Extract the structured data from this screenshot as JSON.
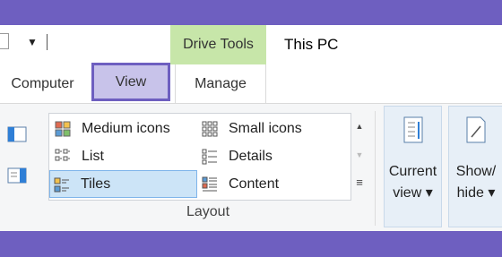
{
  "window": {
    "title": "This PC",
    "context_tab_header": "Drive Tools"
  },
  "tabs": [
    {
      "label": "Computer"
    },
    {
      "label": "View",
      "selected": true
    },
    {
      "label": "Manage"
    }
  ],
  "layout_group": {
    "label": "Layout",
    "items": [
      {
        "label": "Medium icons",
        "icon": "medium-icons-icon"
      },
      {
        "label": "Small icons",
        "icon": "small-icons-icon"
      },
      {
        "label": "List",
        "icon": "list-icon"
      },
      {
        "label": "Details",
        "icon": "details-icon"
      },
      {
        "label": "Tiles",
        "icon": "tiles-icon",
        "selected": true
      },
      {
        "label": "Content",
        "icon": "content-icon"
      }
    ]
  },
  "current_view": {
    "line1": "Current",
    "line2": "view ▾"
  },
  "show_hide": {
    "line1": "Show/",
    "line2": "hide ▾"
  },
  "colors": {
    "accent": "#6e5fc0",
    "context_tab": "#c7e6a9",
    "selection": "#cce4f7"
  }
}
